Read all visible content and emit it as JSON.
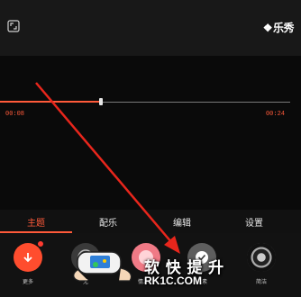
{
  "header": {
    "logo_text": "乐秀"
  },
  "player": {
    "current_time": "00:08",
    "total_time": "00:24",
    "progress": 0.33
  },
  "tabs": [
    {
      "label": "主题",
      "active": true
    },
    {
      "label": "配乐",
      "active": false
    },
    {
      "label": "编辑",
      "active": false
    },
    {
      "label": "设置",
      "active": false
    }
  ],
  "themes": [
    {
      "label": "更多",
      "icon": "download-arrow-icon"
    },
    {
      "label": "无",
      "icon": "none-slash-icon"
    },
    {
      "label": "",
      "icon": "theme-thumbnail"
    },
    {
      "label": "情人节",
      "icon": "valentine-theme-thumbnail"
    },
    {
      "label": "元素",
      "icon": "theme-thumbnail"
    },
    {
      "label": "简洁",
      "icon": "theme-thumbnail"
    }
  ],
  "watermark": {
    "line1": "软 快 提 升",
    "line2": "RK1C.COM"
  },
  "colors": {
    "accent": "#ff5a3a",
    "background": "#0a0a0a"
  }
}
